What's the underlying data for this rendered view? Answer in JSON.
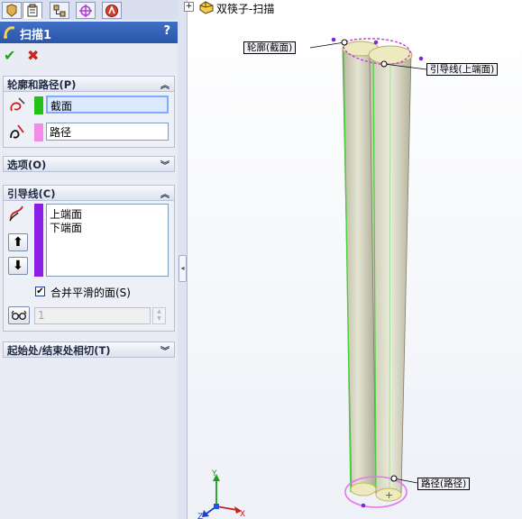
{
  "tree": {
    "expander": "+",
    "feature_label": "双筷子-扫描"
  },
  "pm": {
    "title": "扫描1",
    "help": "?",
    "ok": "✔",
    "cancel": "✖",
    "profile_path": {
      "header": "轮廓和路径(P)",
      "profile_value": "截面",
      "profile_color": "#22c11a",
      "path_value": "路径",
      "path_color": "#f08de8"
    },
    "options": {
      "header": "选项(O)"
    },
    "guides": {
      "header": "引导线(C)",
      "items": [
        "上端面",
        "下端面"
      ],
      "color": "#8a1de6",
      "merge_label": "合并平滑的面(S)",
      "merge_checked": true,
      "spin_value": "1"
    },
    "tangency": {
      "header": "起始处/结束处相切(T)"
    }
  },
  "callouts": {
    "profile": "轮廓(截面)",
    "guide": "引导线(上端面)",
    "path": "路径(路径)"
  },
  "triad": {
    "x": "X",
    "y": "Y",
    "z": "Z"
  }
}
